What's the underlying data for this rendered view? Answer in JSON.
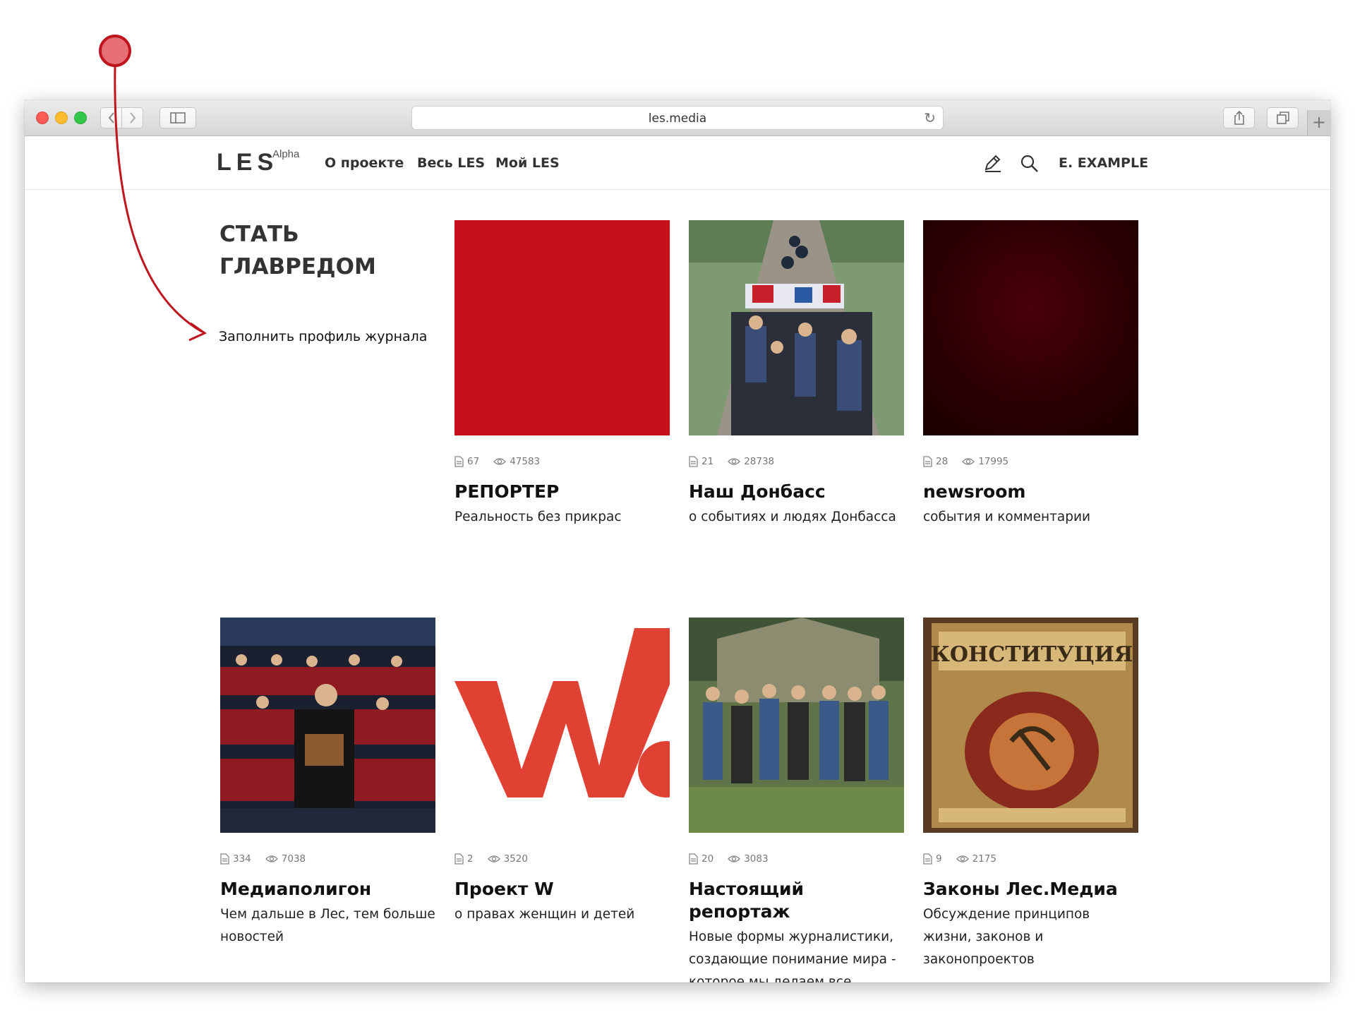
{
  "browser": {
    "url": "les.media",
    "back_icon": "chevron-left-icon",
    "forward_icon": "chevron-right-icon",
    "sidebar_icon": "sidebar-icon",
    "share_icon": "share-icon",
    "tabs_icon": "tabs-icon",
    "new_tab_label": "+"
  },
  "header": {
    "logo": "LES",
    "logo_badge": "Alpha",
    "nav": [
      "О проекте",
      "Весь LES",
      "Мой LES"
    ],
    "edit_icon": "pencil-icon",
    "search_icon": "search-icon",
    "user": "E. EXAMPLE"
  },
  "promo": {
    "title_line1": "СТАТЬ",
    "title_line2": "ГЛАВРЕДОМ",
    "link": "Заполнить профиль журнала"
  },
  "journals": [
    {
      "posts": "67",
      "views": "47583",
      "title": "РЕПОРТЕР",
      "desc": "Реальность без прикрас",
      "image": "solid-red"
    },
    {
      "posts": "21",
      "views": "28738",
      "title": "Наш Донбасс",
      "desc": "о событиях и людях Донбасса",
      "image": "crowd-with-flags-photo"
    },
    {
      "posts": "28",
      "views": "17995",
      "title": "newsroom",
      "desc": "события и комментарии",
      "image": "dark-red-gradient"
    },
    {
      "posts": "334",
      "views": "7038",
      "title": "Медиаполигон",
      "desc": "Чем дальше в Лес, тем больше новостей",
      "image": "cinema-audience-photo"
    },
    {
      "posts": "2",
      "views": "3520",
      "title": "Проект W",
      "desc": "о правах женщин и детей",
      "image": "w-logo"
    },
    {
      "posts": "20",
      "views": "3083",
      "title": "Настоящий репортаж",
      "desc": "Новые формы журналистики, создающие понимание мира - которое мы делаем все вместе.",
      "image": "group-photo"
    },
    {
      "posts": "9",
      "views": "2175",
      "title": "Законы Лес.Медиа",
      "desc": "Обсуждение принципов жизни, законов и законопроектов",
      "image": "constitution-book-photo"
    }
  ],
  "theme": {
    "accent_red": "#c8101a",
    "annotation_red": "#c0151f",
    "text_dark": "#333333"
  }
}
